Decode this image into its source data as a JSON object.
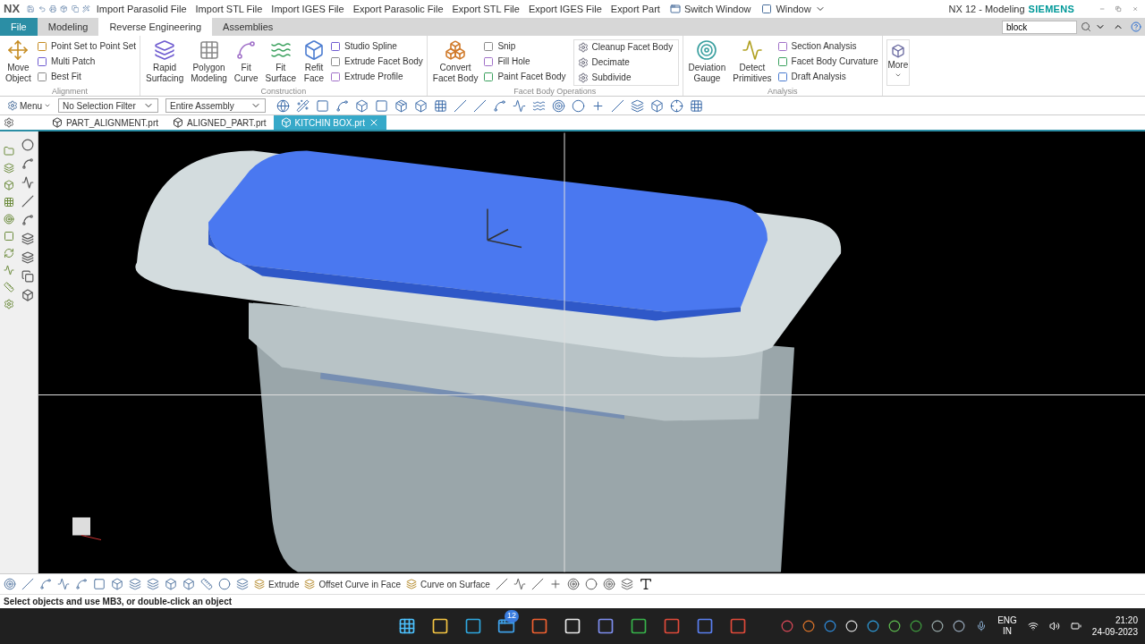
{
  "app_logo": "NX",
  "quick_access": [
    "Import Parasolid File",
    "Import STL File",
    "Import IGES File",
    "Export Parasolic File",
    "Export STL File",
    "Export IGES File",
    "Export Part"
  ],
  "switch_window": "Switch Window",
  "window_menu": "Window",
  "window_title": "NX 12 - Modeling",
  "brand": "SIEMENS",
  "ribbon_tabs": [
    {
      "label": "File",
      "kind": "file",
      "selected": false
    },
    {
      "label": "Modeling",
      "kind": "tab",
      "selected": false
    },
    {
      "label": "Reverse Engineering",
      "kind": "tab",
      "selected": true
    },
    {
      "label": "Assemblies",
      "kind": "tab",
      "selected": false
    }
  ],
  "command_search": {
    "value": "block"
  },
  "ribbon_groups": [
    {
      "title": "Alignment",
      "large": [
        {
          "lines": [
            "Move",
            "Object"
          ]
        }
      ],
      "small": [
        "Point Set to Point Set",
        "Multi Patch",
        "Best Fit"
      ]
    },
    {
      "title": "Construction",
      "large": [
        {
          "lines": [
            "Rapid",
            "Surfacing"
          ]
        },
        {
          "lines": [
            "Polygon",
            "Modeling"
          ]
        },
        {
          "lines": [
            "Fit",
            "Curve"
          ]
        },
        {
          "lines": [
            "Fit",
            "Surface"
          ]
        },
        {
          "lines": [
            "Refit",
            "Face"
          ]
        }
      ],
      "small": [
        "Studio Spline",
        "Extrude Facet Body",
        "Extrude Profile"
      ]
    },
    {
      "title": "Facet Body Operations",
      "large": [
        {
          "lines": [
            "Convert",
            "Facet Body"
          ]
        }
      ],
      "small": [
        "Snip",
        "Fill Hole",
        "Paint Facet Body"
      ],
      "gallery": [
        "Cleanup Facet Body",
        "Decimate",
        "Subdivide"
      ]
    },
    {
      "title": "Analysis",
      "large": [
        {
          "lines": [
            "Deviation",
            "Gauge"
          ]
        },
        {
          "lines": [
            "Detect",
            "Primitives"
          ]
        }
      ],
      "small": [
        "Section Analysis",
        "Facet Body Curvature",
        "Draft Analysis"
      ]
    }
  ],
  "more": "More",
  "toolbar": {
    "menu": "Menu",
    "selection_filter": "No Selection Filter",
    "scope": "Entire Assembly"
  },
  "doc_tabs": [
    {
      "label": "PART_ALIGNMENT.prt",
      "selected": false
    },
    {
      "label": "ALIGNED_PART.prt",
      "selected": false
    },
    {
      "label": "KITCHIN BOX.prt",
      "selected": true
    }
  ],
  "bottom_commands": [
    "Extrude",
    "Offset Curve in Face",
    "Curve on Surface"
  ],
  "status": "Select objects and use MB3, or double-click an object",
  "taskbar": {
    "badge": "12",
    "language": [
      "ENG",
      "IN"
    ],
    "time": "21:20",
    "date": "24-09-2023"
  }
}
